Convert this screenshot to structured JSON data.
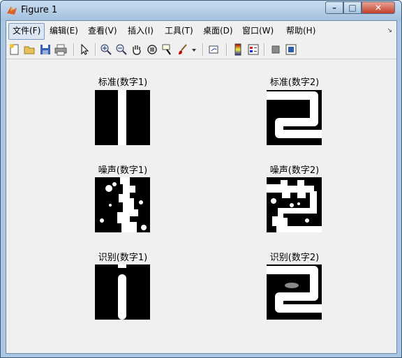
{
  "window": {
    "title": "Figure 1",
    "minimize": "–",
    "maximize": "□",
    "close": "✕"
  },
  "menu": [
    "文件(F)",
    "编辑(E)",
    "查看(V)",
    "插入(I)",
    "工具(T)",
    "桌面(D)",
    "窗口(W)",
    "帮助(H)"
  ],
  "menu_overflow": "↘",
  "toolbar_icons": [
    "new-figure-icon",
    "open-file-icon",
    "save-icon",
    "print-icon",
    "select-arrow-icon",
    "zoom-in-icon",
    "zoom-out-icon",
    "pan-hand-icon",
    "rotate-3d-icon",
    "data-cursor-icon",
    "brush-icon",
    "brush-dropdown-icon",
    "link-plot-icon",
    "colorbar-icon",
    "legend-icon",
    "hide-plot-tools-icon",
    "show-plot-tools-icon"
  ],
  "plots": [
    {
      "title": "标准(数字1)",
      "image": "digit1"
    },
    {
      "title": "标准(数字2)",
      "image": "digit2"
    },
    {
      "title": "噪声(数字1)",
      "image": "noisy1"
    },
    {
      "title": "噪声(数字2)",
      "image": "noisy2"
    },
    {
      "title": "识别(数字1)",
      "image": "digit1-recognized"
    },
    {
      "title": "识别(数字2)",
      "image": "digit2-recognized"
    }
  ]
}
